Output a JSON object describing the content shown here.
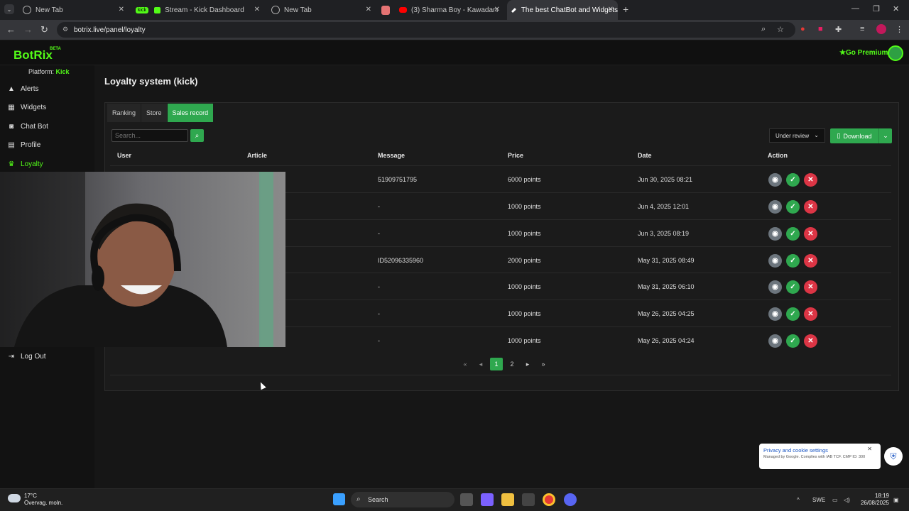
{
  "browser": {
    "tabs": [
      {
        "title": "New Tab",
        "favicon": "globe-icon"
      },
      {
        "badge": "kick",
        "title": "Stream - Kick Dashboard",
        "favicon": "kick-icon"
      },
      {
        "title": "New Tab",
        "favicon": "globe-icon"
      },
      {
        "title": "",
        "favicon": "pink-square-icon"
      },
      {
        "title": "(3) Sharma Boy - Kawadanaada",
        "favicon": "youtube-icon"
      },
      {
        "title": "The best ChatBot and Widgets",
        "favicon": "botrix-icon",
        "active": true
      }
    ],
    "url": "botrix.live/panel/loyalty"
  },
  "app": {
    "logo": "BotRix",
    "logo_badge": "BETA",
    "premium_label": "Go Premium",
    "platform_label": "Platform:",
    "platform_value": "Kick"
  },
  "sidebar": {
    "items": [
      {
        "label": "Alerts",
        "icon": "warning-icon"
      },
      {
        "label": "Widgets",
        "icon": "grid-icon"
      },
      {
        "label": "Chat Bot",
        "icon": "robot-icon"
      },
      {
        "label": "Profile",
        "icon": "id-card-icon"
      },
      {
        "label": "Loyalty",
        "icon": "trophy-icon",
        "active": true
      }
    ],
    "logout_label": "Log Out"
  },
  "main": {
    "title": "Loyalty system (kick)",
    "tabs": [
      "Ranking",
      "Store",
      "Sales record"
    ],
    "active_tab": "Sales record",
    "search_placeholder": "Search...",
    "filter_value": "Under review",
    "download_label": "Download",
    "columns": [
      "User",
      "Article",
      "Message",
      "Price",
      "Date",
      "Action"
    ],
    "rows": [
      {
        "message": "51909751795",
        "price": "6000 points",
        "date": "Jun 30, 2025 08:21"
      },
      {
        "message": "-",
        "price": "1000 points",
        "date": "Jun 4, 2025 12:01"
      },
      {
        "message": "-",
        "price": "1000 points",
        "date": "Jun 3, 2025 08:19"
      },
      {
        "message": "ID52096335960",
        "price": "2000 points",
        "date": "May 31, 2025 08:49"
      },
      {
        "message": "-",
        "price": "1000 points",
        "date": "May 31, 2025 06:10"
      },
      {
        "message": "-",
        "price": "1000 points",
        "date": "May 26, 2025 04:25"
      },
      {
        "message": "-",
        "price": "1000 points",
        "date": "May 26, 2025 04:24"
      }
    ],
    "pagination": {
      "pages": [
        "1",
        "2"
      ],
      "current": "1"
    }
  },
  "cookie": {
    "title": "Privacy and cookie settings",
    "desc": "Managed by Google. Complies with IAB TCF. CMP ID: 300"
  },
  "taskbar": {
    "temperature": "17°C",
    "weather": "Övervag. moln.",
    "search_label": "Search",
    "lang": "SWE",
    "time": "18:19",
    "date": "26/08/2025"
  },
  "colors": {
    "accent": "#53fc18",
    "button_green": "#2fa84f",
    "danger": "#dc3545"
  }
}
